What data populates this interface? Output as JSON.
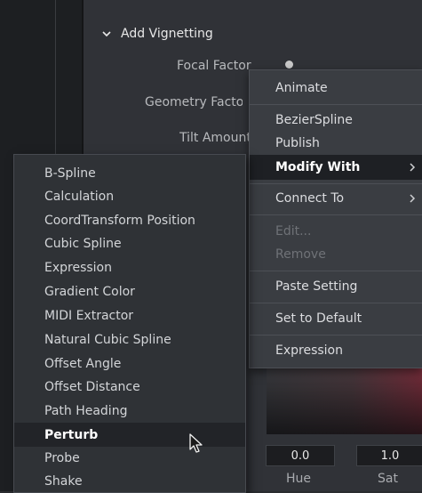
{
  "section": {
    "title": "Add Vignetting"
  },
  "params": [
    {
      "label": "Focal Factor"
    },
    {
      "label": "Geometry Factor"
    },
    {
      "label": "Tilt Amount"
    }
  ],
  "context_menu": {
    "items": [
      {
        "label": "Animate"
      },
      {
        "label": "BezierSpline"
      },
      {
        "label": "Publish"
      },
      {
        "label": "Modify With"
      },
      {
        "label": "Connect To"
      },
      {
        "label": "Edit..."
      },
      {
        "label": "Remove"
      },
      {
        "label": "Paste Setting"
      },
      {
        "label": "Set to Default"
      },
      {
        "label": "Expression"
      }
    ]
  },
  "submenu": {
    "items": [
      "B-Spline",
      "Calculation",
      "CoordTransform Position",
      "Cubic Spline",
      "Expression",
      "Gradient Color",
      "MIDI Extractor",
      "Natural Cubic Spline",
      "Offset Angle",
      "Offset Distance",
      "Path Heading",
      "Perturb",
      "Probe",
      "Shake"
    ]
  },
  "color_controls": {
    "hue": {
      "label": "Hue",
      "value": "0.0"
    },
    "sat": {
      "label": "Sat",
      "value": "1.0"
    }
  }
}
